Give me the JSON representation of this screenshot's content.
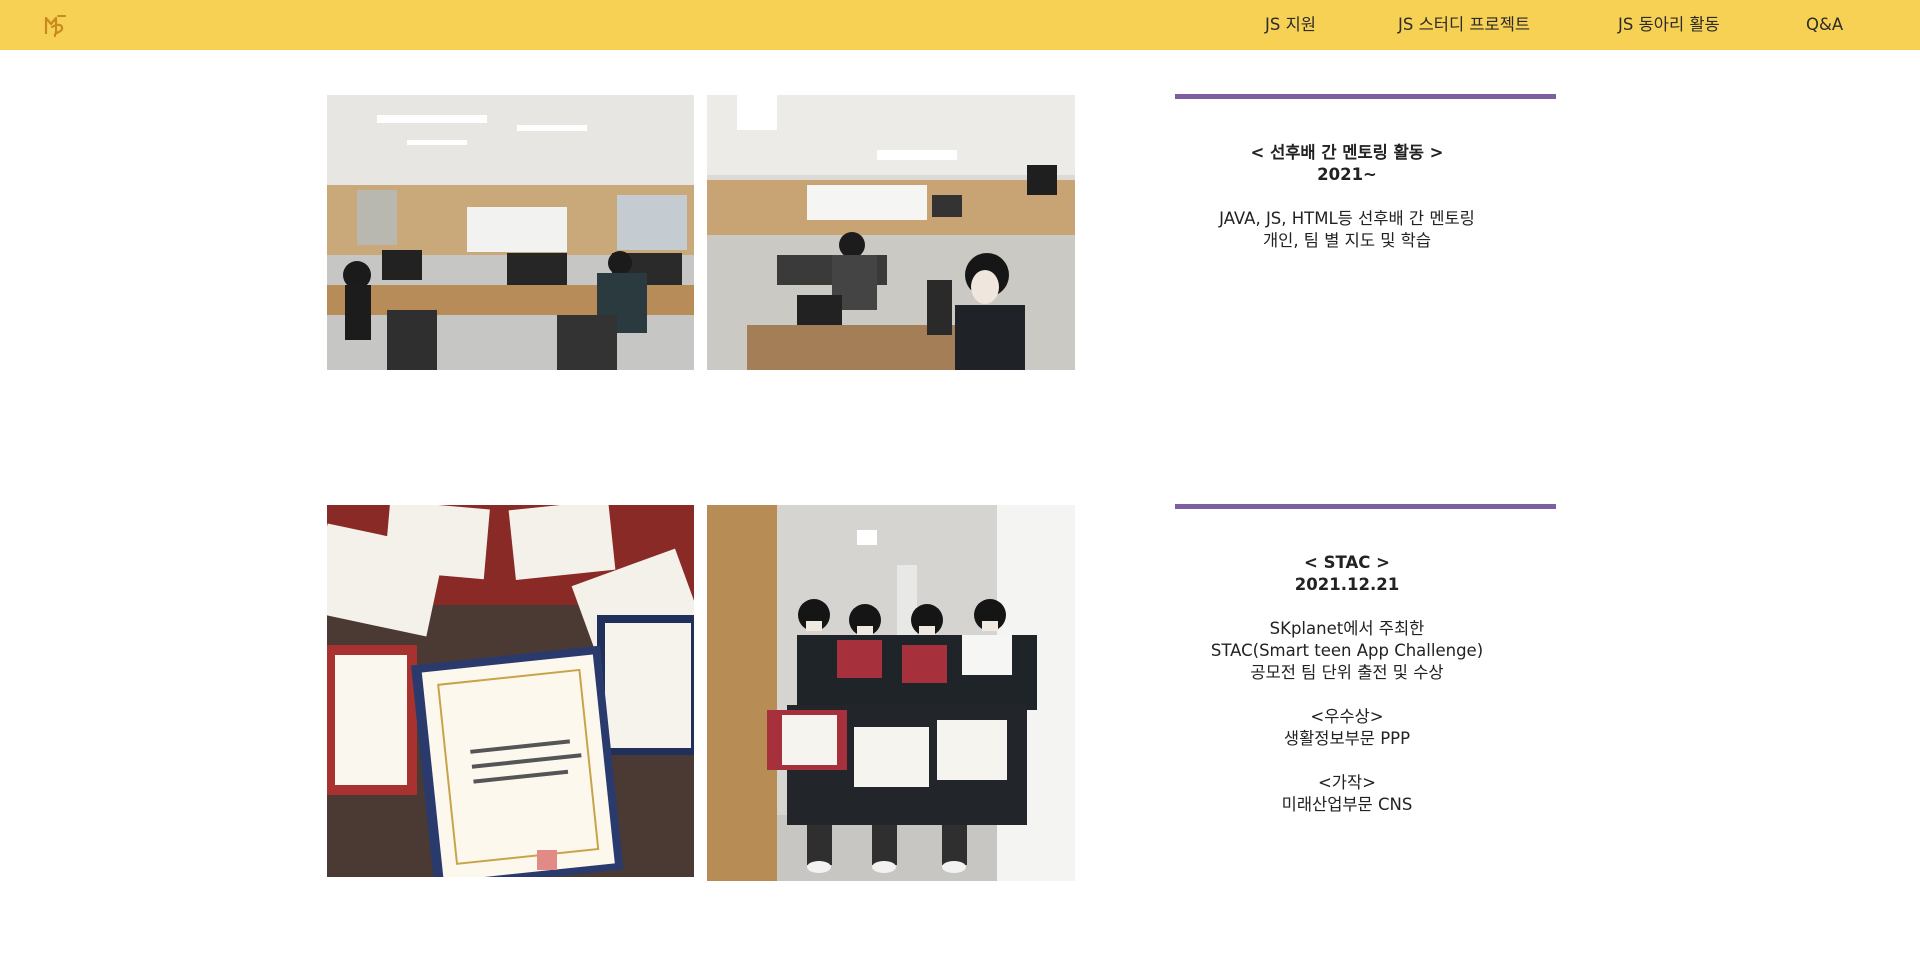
{
  "nav": {
    "logo": "logo-icon",
    "items": [
      "JS 지원",
      "JS 스터디 프로젝트",
      "JS 동아리 활동",
      "Q&A"
    ]
  },
  "sections": [
    {
      "title": "< 선후배 간 멘토링 활동 >",
      "date": "2021~",
      "lines": [
        "JAVA, JS, HTML등 선후배 간 멘토링",
        "개인, 팀 별 지도 및 학습"
      ],
      "photos": [
        "computer-lab-photo",
        "students-at-computers-photo"
      ]
    },
    {
      "title": "< STAC >",
      "date": "2021.12.21",
      "lines": [
        "SKplanet에서 주최한",
        "STAC(Smart teen App Challenge)",
        "공모전 팀 단위 출전 및 수상"
      ],
      "award1_heading": "<우수상>",
      "award1_text": "생활정보부문 PPP",
      "award2_heading": "<가작>",
      "award2_text": "미래산업부문 CNS",
      "photos": [
        "award-certificates-photo",
        "award-winners-group-photo"
      ]
    }
  ],
  "colors": {
    "header": "#f7d154",
    "accent": "#7e5ea3"
  }
}
